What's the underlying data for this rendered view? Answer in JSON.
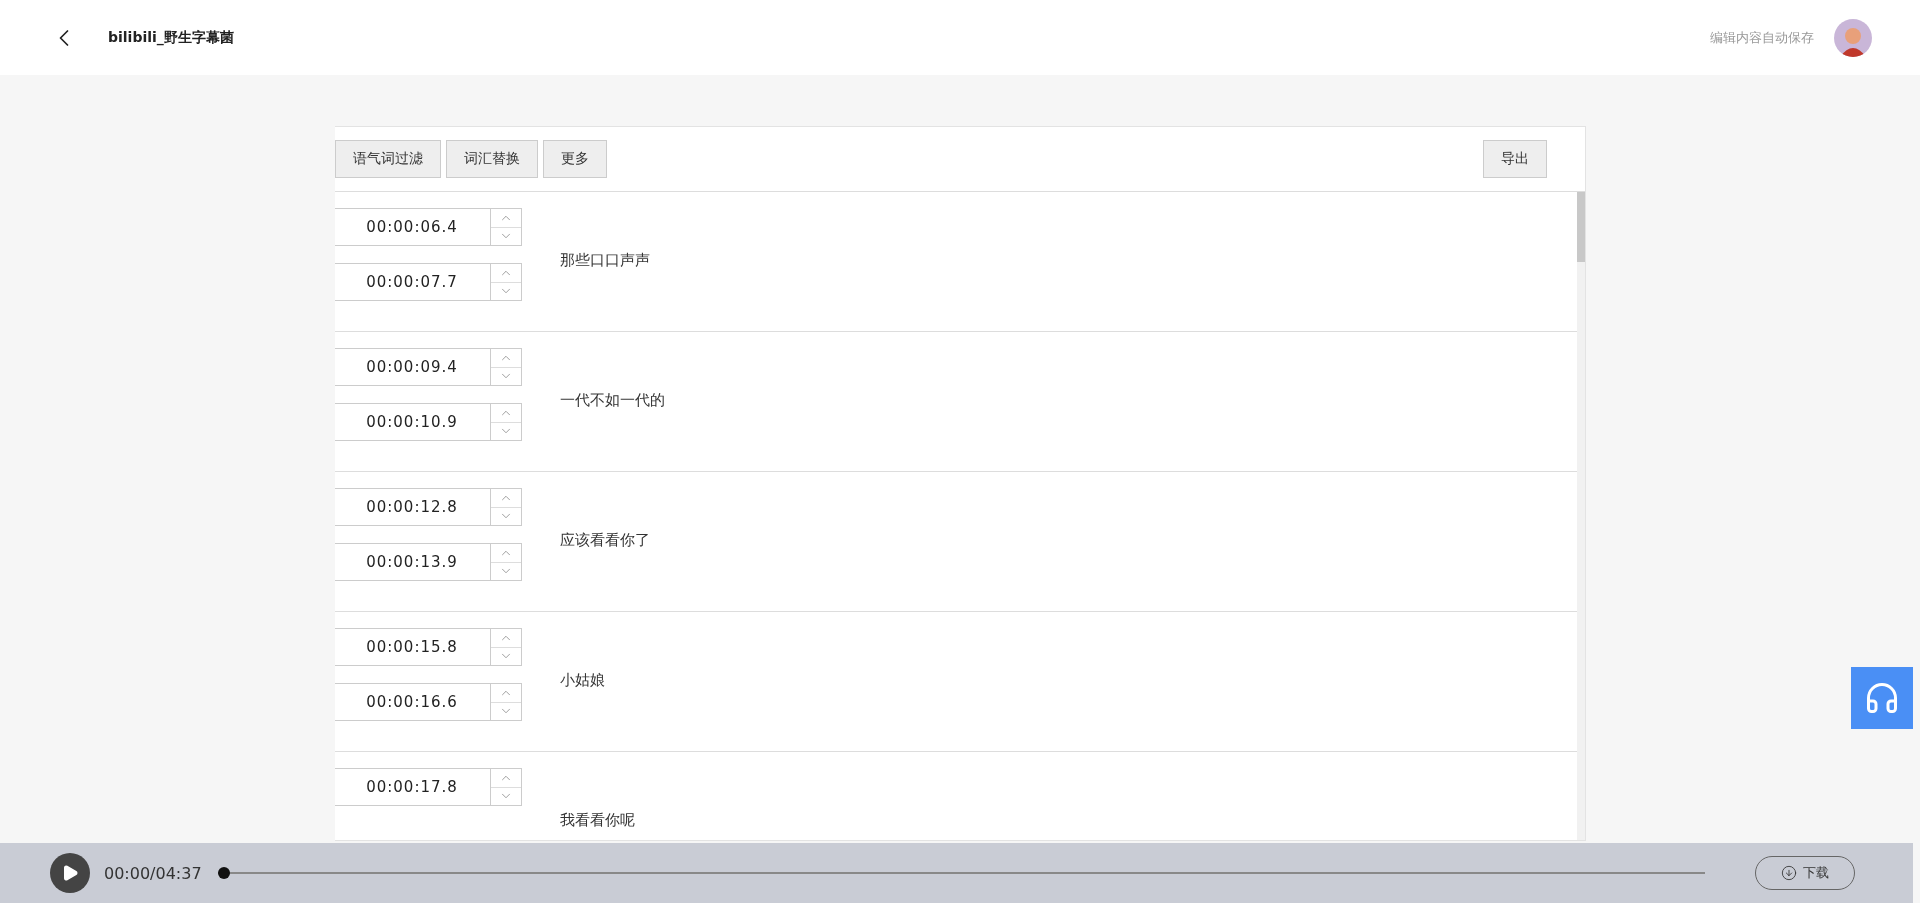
{
  "header": {
    "title": "bilibili_野生字幕菌",
    "save_status": "编辑内容自动保存"
  },
  "toolbar": {
    "buttons": [
      "语气词过滤",
      "词汇替换",
      "更多"
    ],
    "export": "导出"
  },
  "subtitles": [
    {
      "start": "00:00:06.4",
      "end": "00:00:07.7",
      "text": "那些口口声声"
    },
    {
      "start": "00:00:09.4",
      "end": "00:00:10.9",
      "text": "一代不如一代的"
    },
    {
      "start": "00:00:12.8",
      "end": "00:00:13.9",
      "text": "应该看看你了"
    },
    {
      "start": "00:00:15.8",
      "end": "00:00:16.6",
      "text": "小姑娘"
    },
    {
      "start": "00:00:17.8",
      "text": "我看看你呢"
    }
  ],
  "player": {
    "time": "00:00/04:37",
    "level": 0,
    "download": "下载"
  }
}
